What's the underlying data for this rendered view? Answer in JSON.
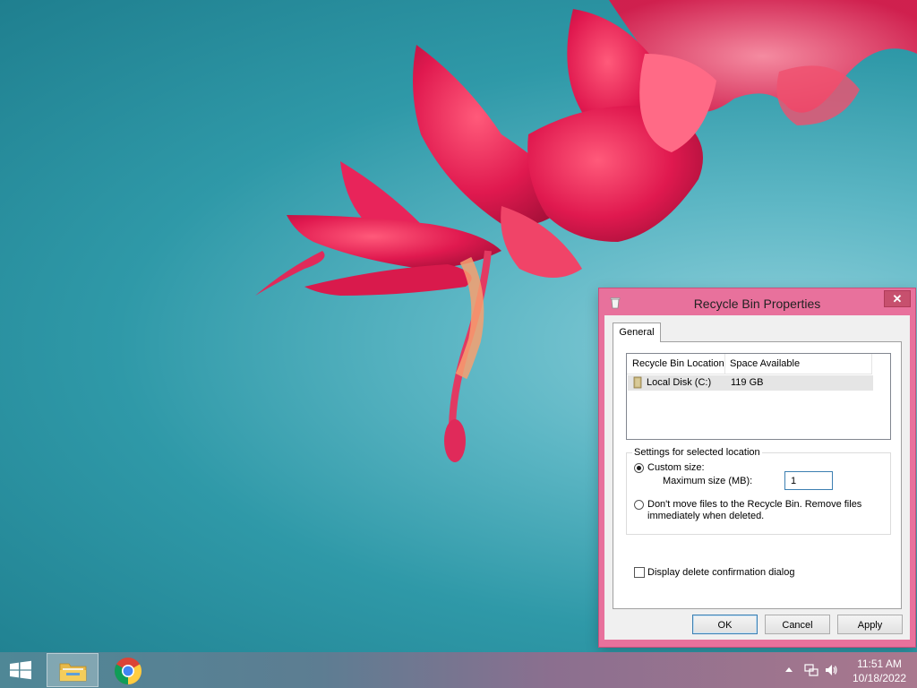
{
  "dialog": {
    "title": "Recycle Bin Properties",
    "close_glyph": "✕",
    "tabs": [
      {
        "label": "General"
      }
    ],
    "list": {
      "columns": [
        "Recycle Bin Location",
        "Space Available"
      ],
      "rows": [
        {
          "icon": "drive-icon",
          "location": "Local Disk (C:)",
          "space": "119 GB"
        }
      ]
    },
    "settings": {
      "group_label": "Settings for selected location",
      "custom_size_label": "Custom size:",
      "custom_size_selected": true,
      "max_size_label": "Maximum size (MB):",
      "max_size_value": "1",
      "dont_move_label_line1": "Don't move files to the Recycle Bin. Remove files",
      "dont_move_label_line2": "immediately when deleted.",
      "dont_move_selected": false
    },
    "confirm_label": "Display delete confirmation dialog",
    "confirm_checked": false,
    "buttons": {
      "ok": "OK",
      "cancel": "Cancel",
      "apply": "Apply"
    }
  },
  "taskbar": {
    "apps": [
      {
        "name": "file-explorer",
        "icon": "folder-icon",
        "active": true
      },
      {
        "name": "chrome",
        "icon": "chrome-icon",
        "active": false
      }
    ],
    "tray_icons": [
      "chevron-up-icon",
      "network-icon",
      "volume-icon"
    ],
    "clock_time": "11:51 AM",
    "clock_date": "10/18/2022"
  },
  "colors": {
    "dialog_frame": "#e8719c",
    "close_button": "#c7506e",
    "desktop_teal": "#2f99a8",
    "flower_red": "#e0194f"
  }
}
